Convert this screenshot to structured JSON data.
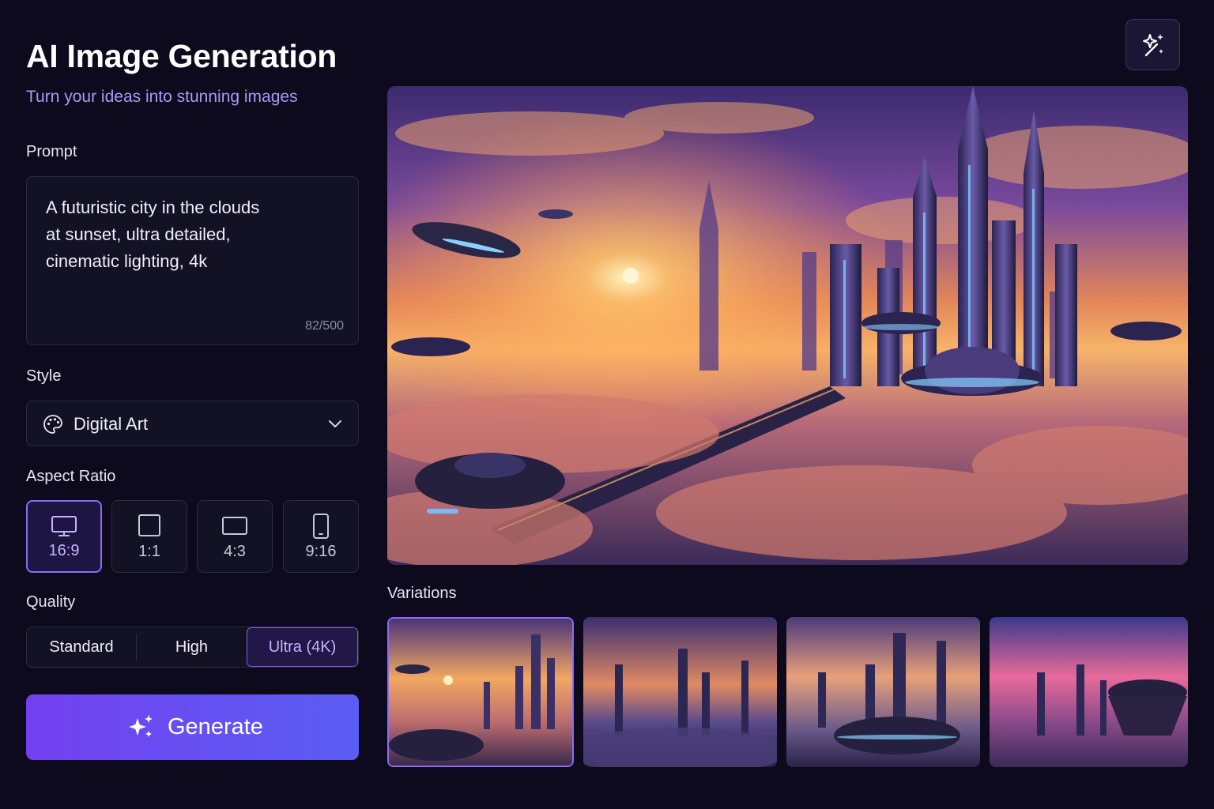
{
  "header": {
    "title": "AI Image Generation",
    "subtitle": "Turn your ideas into stunning images"
  },
  "prompt": {
    "label": "Prompt",
    "lines": [
      "A futuristic city in the clouds",
      "at sunset, ultra detailed,",
      "cinematic lighting, 4k"
    ],
    "char_count": "82/500"
  },
  "style": {
    "label": "Style",
    "value": "Digital Art",
    "icon": "palette-icon"
  },
  "aspect_ratio": {
    "label": "Aspect Ratio",
    "options": [
      {
        "label": "16:9",
        "icon": "monitor-icon",
        "selected": true
      },
      {
        "label": "1:1",
        "icon": "square-icon",
        "selected": false
      },
      {
        "label": "4:3",
        "icon": "rectangle-icon",
        "selected": false
      },
      {
        "label": "9:16",
        "icon": "phone-icon",
        "selected": false
      }
    ]
  },
  "quality": {
    "label": "Quality",
    "options": [
      "Standard",
      "High",
      "Ultra (4K)"
    ],
    "selected": "Ultra (4K)"
  },
  "generate": {
    "label": "Generate",
    "icon": "sparkles-icon"
  },
  "magic_button": {
    "icon": "magic-wand-sparkle-icon"
  },
  "variations": {
    "label": "Variations",
    "count": 4,
    "selected_index": 0
  },
  "colors": {
    "background": "#0c0a1c",
    "accent": "#8b6cf6",
    "generate_start": "#7340f0",
    "generate_end": "#5a5ef2",
    "subtitle": "#a99cf2"
  }
}
